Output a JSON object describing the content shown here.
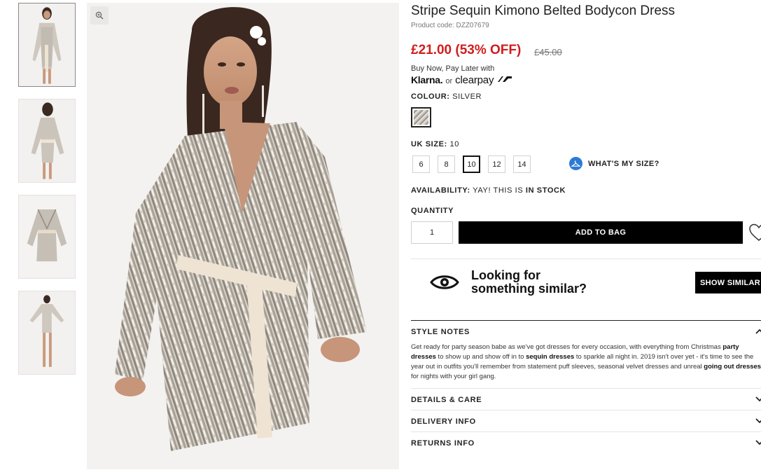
{
  "product": {
    "title": "Stripe Sequin Kimono Belted Bodycon Dress",
    "code": "Product code: DZZ07679",
    "price": "£21.00 (53% OFF)",
    "old_price": "£45.00"
  },
  "payment": {
    "bnpl_text": "Buy Now, Pay Later with",
    "klarna": "Klarna.",
    "or": "or",
    "clearpay": "clearpay"
  },
  "colour": {
    "label": "COLOUR:",
    "value": "SILVER"
  },
  "size": {
    "label": "UK SIZE:",
    "value": "10",
    "options": [
      "6",
      "8",
      "10",
      "12",
      "14"
    ],
    "selected": "10",
    "whats_my_size": "WHAT'S MY SIZE?"
  },
  "availability": {
    "label": "AVAILABILITY:",
    "text": "YAY! THIS IS",
    "status": "IN STOCK"
  },
  "quantity": {
    "label": "QUANTITY",
    "value": "1"
  },
  "buttons": {
    "add_to_bag": "ADD TO BAG",
    "show_similar": "SHOW SIMILAR"
  },
  "similar": {
    "line1": "Looking for",
    "line2": "something similar?"
  },
  "accordion": {
    "style_notes": "STYLE NOTES",
    "details": "DETAILS & CARE",
    "delivery": "DELIVERY INFO",
    "returns": "RETURNS INFO"
  },
  "style_notes": {
    "p1": "Get ready for party season babe as we've got dresses for every occasion, with everything from Christmas ",
    "link1": "party dresses",
    "p2": " to show up and show off in to ",
    "link2": "sequin dresses",
    "p3": " to sparkle all night in. 2019 isn't over yet - it's time to see the year out in outfits you'll remember from statement puff sleeves, seasonal velvet dresses and unreal ",
    "link3": "going out dresses",
    "p4": " for nights with your girl gang."
  },
  "colors": {
    "price_red": "#d01e1e",
    "accent_blue": "#2c7ad6",
    "black": "#000000"
  }
}
